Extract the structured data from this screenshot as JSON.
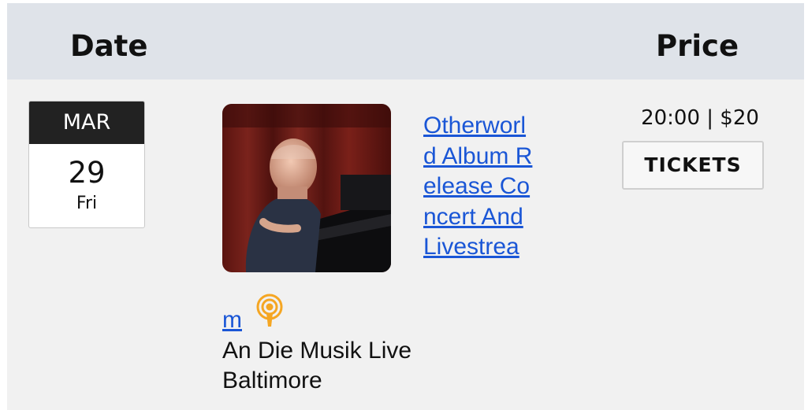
{
  "table": {
    "headers": {
      "date": "Date",
      "price": "Price"
    },
    "events": [
      {
        "month": "MAR",
        "day": "29",
        "weekday": "Fri",
        "title_wrapped_main": "Otherworld Album Release Concert And Livestrea",
        "title_wrapped_tail": "m",
        "venue": "An Die Musik Live Baltimore",
        "time_price": "20:00 | $20",
        "tickets_label": "TICKETS"
      }
    ]
  },
  "icons": {
    "event_photo": "pianist-photo",
    "podcast": "podcast-icon"
  },
  "colors": {
    "header_bg": "#dfe3e9",
    "row_bg": "#f1f1f1",
    "link": "#1a56d6",
    "month_bg": "#222222",
    "podcast_orange": "#f5a623"
  }
}
